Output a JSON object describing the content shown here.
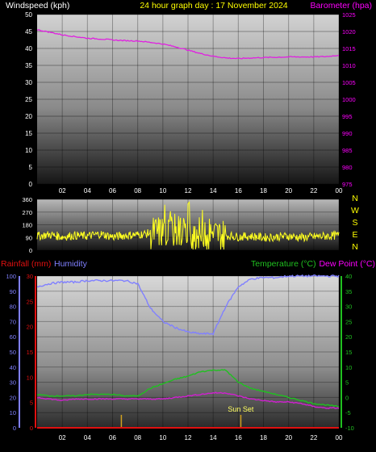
{
  "header": {
    "left_title": "Windspeed (kph)",
    "center_title": "24 hour graph day : 17 November 2024",
    "right_title": "Barometer (hpa)"
  },
  "colors": {
    "windspeed": "#ffffff",
    "gust": "#bfbfbf",
    "windavg": "#3fe33f",
    "barometer": "#e020e0",
    "direction": "#ffff20",
    "rainfall": "#e01010",
    "humidity": "#8080ff",
    "temperature": "#20c020",
    "dewpoint": "#d020d0",
    "sun_line": "#d0a020",
    "title_left": "#ffffff",
    "title_center": "#ffff00",
    "title_right": "#ff00ff"
  },
  "middle_panel": {
    "compass_labels": [
      "N",
      "W",
      "S",
      "E",
      "N"
    ]
  },
  "bottom_panel": {
    "rainfall_label": "Rainfall (mm)",
    "humidity_label": "Humidity",
    "temperature_label": "Temperature (°C)",
    "dewpoint_label": "Dew Point (°C)",
    "annotation": "Sun Set"
  },
  "chart_data": [
    {
      "type": "line",
      "title": "24 hour graph day : 17 November 2024",
      "ylabel": "Windspeed (kph)",
      "y2label": "Barometer (hpa)",
      "ylim": [
        0,
        50
      ],
      "y2lim": [
        975,
        1025
      ],
      "yticks": [
        0,
        5,
        10,
        15,
        20,
        25,
        30,
        35,
        40,
        45,
        50
      ],
      "y2ticks": [
        975,
        980,
        985,
        990,
        995,
        1000,
        1005,
        1010,
        1015,
        1020,
        1025
      ],
      "x_ticks": [
        "02",
        "04",
        "06",
        "08",
        "10",
        "12",
        "14",
        "16",
        "18",
        "20",
        "22",
        "00"
      ],
      "xlim": [
        0,
        24
      ],
      "grid": true,
      "series": [
        {
          "name": "Barometer (hpa)",
          "axis": "right",
          "x": [
            0,
            1,
            2,
            3,
            4,
            5,
            6,
            7,
            8,
            9,
            10,
            11,
            12,
            13,
            14,
            15,
            16,
            17,
            18,
            19,
            20,
            21,
            22,
            23,
            24
          ],
          "values": [
            1020.5,
            1019.8,
            1019.0,
            1018.5,
            1018.0,
            1017.8,
            1017.5,
            1017.3,
            1017.2,
            1016.8,
            1016.3,
            1015.5,
            1014.5,
            1013.5,
            1012.7,
            1012.2,
            1012.0,
            1012.2,
            1012.3,
            1012.4,
            1012.5,
            1012.5,
            1012.5,
            1012.6,
            1013.0
          ]
        },
        {
          "name": "",
          "role": "gust",
          "axis": "left",
          "x": [
            0,
            1,
            2,
            3,
            4,
            5,
            6,
            7,
            8,
            9,
            10,
            11,
            12,
            13,
            14,
            15,
            16,
            17,
            18,
            19,
            20,
            21,
            22,
            23,
            24
          ],
          "values": [
            4,
            4,
            3,
            4,
            3,
            3,
            4,
            3,
            4,
            7,
            10,
            11,
            9,
            10,
            8,
            7,
            4,
            3,
            3,
            4,
            3,
            3,
            4,
            3,
            4
          ]
        },
        {
          "name": "",
          "role": "windspeed",
          "axis": "left",
          "x": [
            0,
            1,
            2,
            3,
            4,
            5,
            6,
            7,
            8,
            9,
            10,
            11,
            12,
            13,
            14,
            15,
            16,
            17,
            18,
            19,
            20,
            21,
            22,
            23,
            24
          ],
          "values": [
            2,
            2,
            2,
            2,
            1.5,
            2,
            2,
            2,
            2,
            4,
            6,
            6,
            5,
            5,
            5,
            4,
            2,
            1.5,
            2,
            2,
            1.5,
            2,
            2,
            2,
            2
          ]
        },
        {
          "name": "",
          "role": "average",
          "axis": "left",
          "x": [
            0,
            1,
            2,
            3,
            4,
            5,
            6,
            7,
            8,
            9,
            10,
            11,
            12,
            13,
            14,
            15,
            16,
            17,
            18,
            19,
            20,
            21,
            22,
            23,
            24
          ],
          "values": [
            1,
            1,
            1,
            1,
            1,
            1,
            1,
            1,
            1.5,
            2.5,
            3.5,
            4,
            3.5,
            3.5,
            3,
            2.5,
            1,
            1,
            1,
            1,
            1,
            1,
            1,
            1,
            1
          ]
        }
      ]
    },
    {
      "type": "line",
      "ylabel": "",
      "ylim": [
        0,
        360
      ],
      "yticks": [
        0,
        90,
        180,
        270,
        360
      ],
      "xlim": [
        0,
        24
      ],
      "series": [
        {
          "name": "",
          "role": "wind_direction",
          "x": [
            0,
            1,
            2,
            3,
            4,
            5,
            6,
            7,
            8,
            9,
            10,
            11,
            12,
            13,
            14,
            15,
            16,
            17,
            18,
            19,
            20,
            21,
            22,
            23,
            24
          ],
          "values": [
            100,
            110,
            95,
            105,
            100,
            115,
            95,
            105,
            110,
            120,
            130,
            140,
            125,
            115,
            110,
            105,
            95,
            100,
            90,
            95,
            100,
            90,
            95,
            100,
            105
          ]
        }
      ]
    },
    {
      "type": "line",
      "ylabel": "Rainfall (mm)",
      "y2label": "Humidity",
      "y3label": "Temperature (°C)",
      "y4label": "Dew Point (°C)",
      "humidity_ylim": [
        0,
        100
      ],
      "humidity_yticks": [
        0,
        10,
        20,
        30,
        40,
        50,
        60,
        70,
        80,
        90,
        100
      ],
      "rain_ylim": [
        0,
        30
      ],
      "rain_yticks": [
        0,
        5,
        10,
        15,
        20,
        25,
        30
      ],
      "temp_ylim": [
        -10,
        40
      ],
      "temp_yticks": [
        -10,
        -5,
        0,
        5,
        10,
        15,
        20,
        25,
        30,
        35,
        40
      ],
      "x_ticks": [
        "02",
        "04",
        "06",
        "08",
        "10",
        "12",
        "14",
        "16",
        "18",
        "20",
        "22",
        "00"
      ],
      "xlim": [
        0,
        24
      ],
      "sun_events": [
        {
          "label": "",
          "x": 6.7
        },
        {
          "label": "Sun Set",
          "x": 16.2
        }
      ],
      "series": [
        {
          "name": "Humidity",
          "axis": "humidity",
          "x": [
            0,
            1,
            2,
            3,
            4,
            5,
            6,
            7,
            8,
            9,
            10,
            11,
            12,
            13,
            14,
            15,
            16,
            17,
            18,
            19,
            20,
            21,
            22,
            23,
            24
          ],
          "values": [
            93,
            95,
            96,
            96,
            97,
            97,
            97,
            97,
            95,
            79,
            70,
            66,
            63,
            62,
            62,
            80,
            93,
            98,
            99,
            99,
            100,
            100,
            100,
            100,
            100
          ]
        },
        {
          "name": "Temperature (°C)",
          "axis": "temp",
          "x": [
            0,
            1,
            2,
            3,
            4,
            5,
            6,
            7,
            8,
            9,
            10,
            11,
            12,
            13,
            14,
            15,
            16,
            17,
            18,
            19,
            20,
            21,
            22,
            23,
            24
          ],
          "values": [
            1,
            0.5,
            0.5,
            0.5,
            1,
            1,
            1,
            0.5,
            0.5,
            3,
            4.5,
            6,
            7,
            8.5,
            9,
            9,
            5,
            3,
            2,
            1,
            0,
            -1,
            -2,
            -2.5,
            -3
          ]
        },
        {
          "name": "Dew Point (°C)",
          "axis": "temp",
          "x": [
            0,
            1,
            2,
            3,
            4,
            5,
            6,
            7,
            8,
            9,
            10,
            11,
            12,
            13,
            14,
            15,
            16,
            17,
            18,
            19,
            20,
            21,
            22,
            23,
            24
          ],
          "values": [
            0,
            -0.5,
            -1,
            -0.5,
            -0.5,
            -0.5,
            -0.5,
            -0.5,
            -0.5,
            -0.5,
            -0.5,
            0,
            0.5,
            1,
            1.5,
            1.5,
            0.5,
            -0.5,
            -1,
            -1.5,
            -1.5,
            -2,
            -3,
            -3.5,
            -3.5
          ]
        },
        {
          "name": "Rainfall (mm)",
          "axis": "rain",
          "x": [
            0,
            24
          ],
          "values": [
            0,
            0
          ]
        }
      ]
    }
  ]
}
